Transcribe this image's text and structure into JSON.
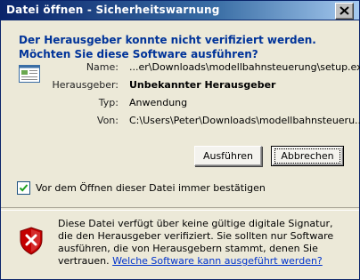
{
  "window": {
    "title": "Datei öffnen - Sicherheitswarnung"
  },
  "heading": "Der Herausgeber konnte nicht verifiziert werden. Möchten Sie diese Software ausführen?",
  "details": {
    "name_label": "Name:",
    "name_value": "...er\\Downloads\\modellbahnsteuerung\\setup.exe",
    "publisher_label": "Herausgeber:",
    "publisher_value": "Unbekannter Herausgeber",
    "type_label": "Typ:",
    "type_value": "Anwendung",
    "from_label": "Von:",
    "from_value": "C:\\Users\\Peter\\Downloads\\modellbahnsteueru..."
  },
  "buttons": {
    "run": "Ausführen",
    "cancel": "Abbrechen"
  },
  "checkbox": {
    "label": "Vor dem Öffnen dieser Datei immer bestätigen",
    "checked": true
  },
  "warning": {
    "text": "Diese Datei verfügt über keine gültige digitale Signatur, die den Herausgeber verifiziert. Sie sollten nur Software ausführen, die von Herausgebern stammt, denen Sie vertrauen.",
    "link": "Welche Software kann ausgeführt werden?"
  },
  "colors": {
    "title_start": "#0a246a",
    "title_end": "#a6caf0",
    "heading": "#003399",
    "link": "#0033cc",
    "shield_red": "#c40000"
  },
  "icons": {
    "close": "close-icon",
    "file": "file-icon",
    "shield": "shield-x-icon",
    "check": "check-icon"
  }
}
